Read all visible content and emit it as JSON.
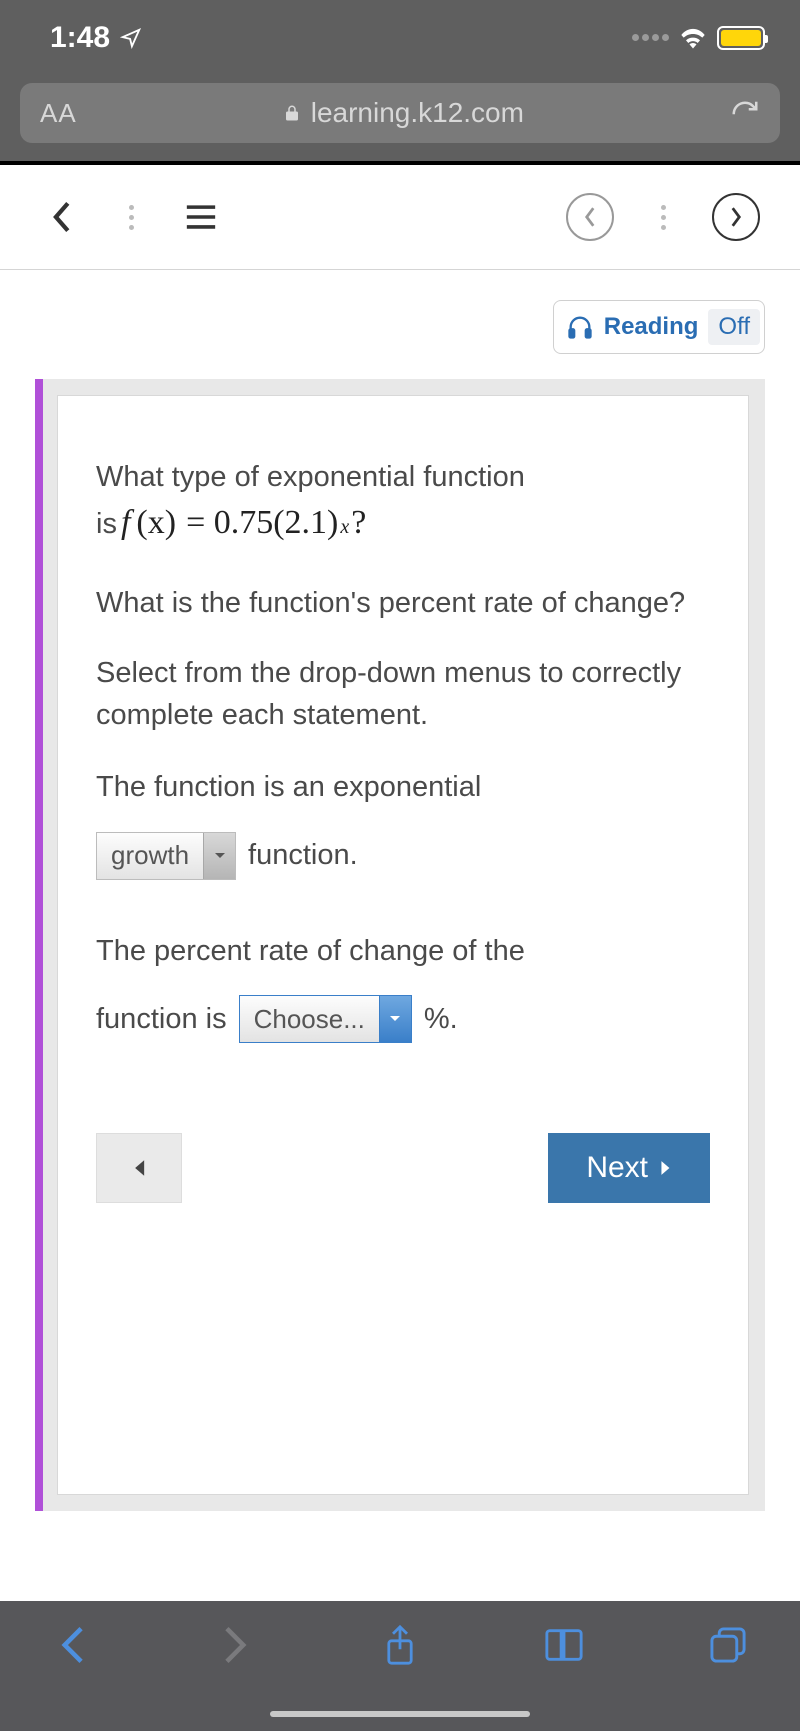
{
  "status": {
    "time": "1:48"
  },
  "url_bar": {
    "aa": "AA",
    "domain": "learning.k12.com"
  },
  "reading": {
    "label": "Reading",
    "state": "Off"
  },
  "question": {
    "line1": "What type of exponential function",
    "formula_is": "is",
    "formula_f": "f",
    "formula_x": "(x)",
    "formula_eq": "= 0.75(2.1)",
    "formula_sup": "x",
    "formula_end": " ?",
    "line2": "What is the function's percent rate of change?",
    "line3": "Select from the drop-down menus to correctly complete each statement.",
    "stmt1": "The function is an exponential",
    "dd1": "growth",
    "stmt1_tail": "function.",
    "stmt2a": "The percent rate of change of the",
    "stmt2b": "function is",
    "dd2": "Choose...",
    "stmt2_tail": "%."
  },
  "buttons": {
    "next": "Next"
  }
}
